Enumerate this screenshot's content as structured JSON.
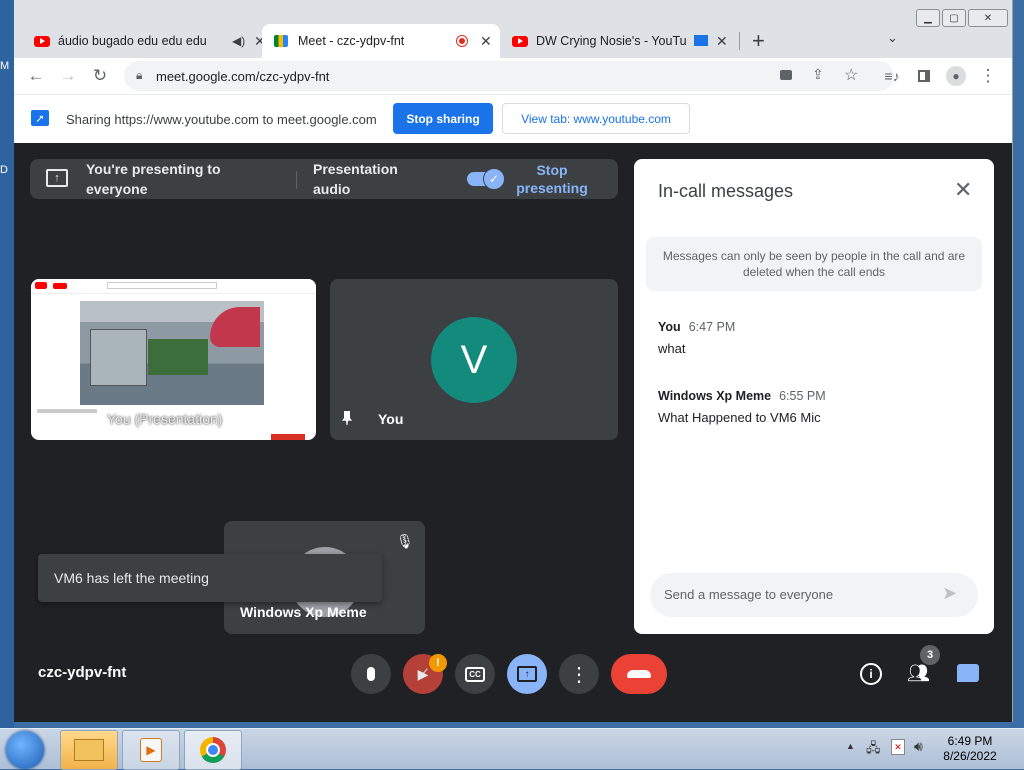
{
  "browser": {
    "tabs": [
      {
        "title": "áudio bugado edu edu edu",
        "icon": "youtube",
        "audio": true
      },
      {
        "title": "Meet - czc-ydpv-fnt",
        "icon": "google-meet",
        "recording": true
      },
      {
        "title": "DW Crying Nosie's - YouTube",
        "icon": "youtube",
        "casting": true
      }
    ],
    "url": "meet.google.com/czc-ydpv-fnt",
    "new_tab_symbol": "+"
  },
  "infobar": {
    "sharing_text": "Sharing https://www.youtube.com to meet.google.com",
    "stop_sharing": "Stop sharing",
    "view_tab": "View tab: www.youtube.com"
  },
  "meet": {
    "presenting_line1": "You're presenting to",
    "presenting_line2": "everyone",
    "presentation_audio_1": "Presentation",
    "presentation_audio_2": "audio",
    "stop_presenting_1": "Stop",
    "stop_presenting_2": "presenting",
    "presentation_tile_label": "You (Presentation)",
    "you_tile_avatar": "V",
    "you_tile_name": "You",
    "xp_tile_name": "Windows Xp Meme",
    "toast": "VM6 has left the meeting",
    "meeting_code": "czc-ydpv-fnt",
    "participants_count": "3",
    "camera_alert": "!"
  },
  "chat": {
    "title": "In-call messages",
    "notice": "Messages can only be seen by people in the call and are deleted when the call ends",
    "messages": [
      {
        "sender": "You",
        "time": "6:47 PM",
        "text": "what"
      },
      {
        "sender": "Windows Xp Meme",
        "time": "6:55 PM",
        "text": "What Happened to VM6 Mic"
      }
    ],
    "input_placeholder": "Send a message to everyone"
  },
  "taskbar": {
    "time": "6:49 PM",
    "date": "8/26/2022"
  },
  "desktop": {
    "label_m": "M",
    "label_d": "D"
  },
  "colors": {
    "meet_bg": "#202124",
    "accent_blue": "#1a73e8",
    "end_call_red": "#ea4335",
    "avatar_teal": "#128a7c"
  }
}
